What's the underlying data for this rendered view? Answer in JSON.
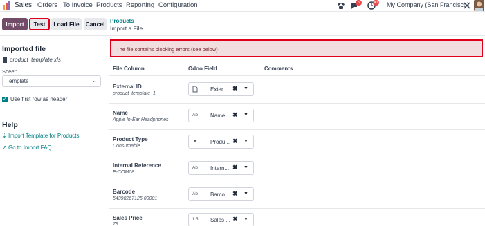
{
  "navbar": {
    "app_name": "Sales",
    "menu": [
      "Orders",
      "To Invoice",
      "Products",
      "Reporting",
      "Configuration"
    ],
    "messages_count": "5",
    "activities_count": "41",
    "company": "My Company (San Francisco)",
    "icons": [
      "apps-logo-icon",
      "phone-icon",
      "chat-icon",
      "clock-icon",
      "tools-icon"
    ]
  },
  "control_panel": {
    "import_label": "Import",
    "test_label": "Test",
    "load_file_label": "Load File",
    "cancel_label": "Cancel",
    "breadcrumb_parent": "Products",
    "breadcrumb_current": "Import a File"
  },
  "sidebar": {
    "imported_file_title": "Imported file",
    "file_name": "product_template.xls",
    "sheet_label": "Sheet:",
    "sheet_value": "Template",
    "header_checkbox_label": "Use first row as header",
    "help_title": "Help",
    "help_links": [
      "Import Template for Products",
      "Go to Import FAQ"
    ]
  },
  "error": {
    "message": "The file contains blocking errors (see below)"
  },
  "table": {
    "headers": [
      "File Column",
      "Odoo Field",
      "Comments"
    ],
    "rows": [
      {
        "name": "External ID",
        "sample": "product_template_1",
        "field": "Exter...",
        "type_icon": "file-icon"
      },
      {
        "name": "Name",
        "sample": "Apple In-Ear Headphones",
        "field": "Name",
        "type_icon": "text-icon"
      },
      {
        "name": "Product Type",
        "sample": "Consumable",
        "field": "Produ...",
        "type_icon": "selection-icon"
      },
      {
        "name": "Internal Reference",
        "sample": "E-COM08",
        "field": "Intern...",
        "type_icon": "text-icon"
      },
      {
        "name": "Barcode",
        "sample": "54398267125.00001",
        "field": "Barco...",
        "type_icon": "text-icon"
      },
      {
        "name": "Sales Price",
        "sample": "79",
        "field": "Sales ...",
        "type_icon": "float-icon"
      }
    ],
    "type_glyphs": {
      "text": "Ab",
      "float": "1.5"
    }
  },
  "colors": {
    "brand": "#714b67",
    "link": "#017e84",
    "error_bg": "#f2dede",
    "highlight": "#e0001b"
  }
}
